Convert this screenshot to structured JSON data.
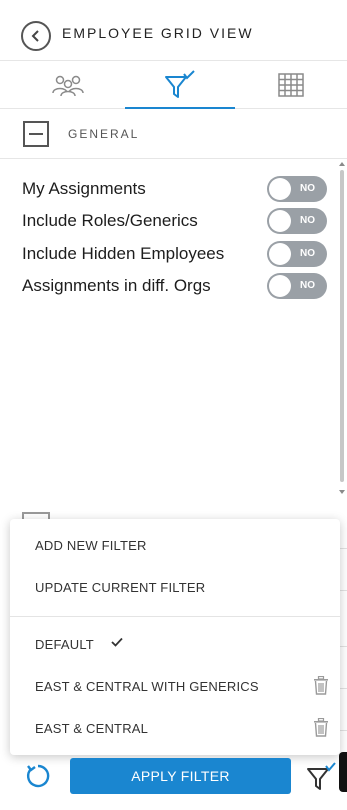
{
  "header": {
    "title": "EMPLOYEE GRID VIEW",
    "back_icon": "chevron-left-icon"
  },
  "tabs": [
    {
      "icon": "people-icon"
    },
    {
      "icon": "filter-check-icon",
      "active": true
    },
    {
      "icon": "grid-icon"
    }
  ],
  "section": {
    "title": "GENERAL"
  },
  "toggles": [
    {
      "label": "My Assignments",
      "state": "NO"
    },
    {
      "label": "Include Roles/Generics",
      "state": "NO"
    },
    {
      "label": "Include Hidden Employees",
      "state": "NO"
    },
    {
      "label": "Assignments in diff. Orgs",
      "state": "NO"
    }
  ],
  "menu": {
    "actions": [
      "ADD NEW FILTER",
      "UPDATE CURRENT FILTER"
    ],
    "filters": [
      {
        "label": "DEFAULT",
        "selected": true,
        "deletable": false
      },
      {
        "label": "EAST & CENTRAL WITH GENERICS",
        "selected": false,
        "deletable": true
      },
      {
        "label": "EAST & CENTRAL",
        "selected": false,
        "deletable": true
      }
    ]
  },
  "footer": {
    "apply_label": "APPLY FILTER"
  },
  "colors": {
    "accent": "#1a86d0",
    "toggle_off": "#9aa0a6",
    "text": "#1d1d1d"
  }
}
